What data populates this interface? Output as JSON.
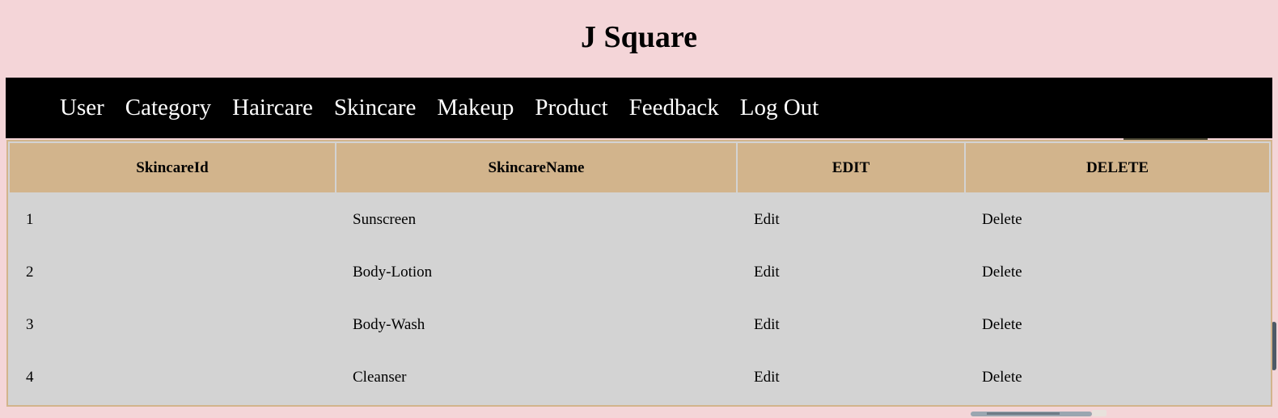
{
  "site": {
    "title": "J Square"
  },
  "nav": {
    "items": [
      {
        "label": "User"
      },
      {
        "label": "Category"
      },
      {
        "label": "Haircare"
      },
      {
        "label": "Skincare"
      },
      {
        "label": "Makeup"
      },
      {
        "label": "Product"
      },
      {
        "label": "Feedback"
      },
      {
        "label": "Log Out"
      }
    ]
  },
  "table": {
    "headers": {
      "id": "SkincareId",
      "name": "SkincareName",
      "edit": "EDIT",
      "delete": "DELETE"
    },
    "rows": [
      {
        "id": "1",
        "name": "Sunscreen",
        "edit": "Edit",
        "delete": "Delete"
      },
      {
        "id": "2",
        "name": "Body-Lotion",
        "edit": "Edit",
        "delete": "Delete"
      },
      {
        "id": "3",
        "name": "Body-Wash",
        "edit": "Edit",
        "delete": "Delete"
      },
      {
        "id": "4",
        "name": "Cleanser",
        "edit": "Edit",
        "delete": "Delete"
      }
    ]
  },
  "colors": {
    "page_background": "#f4d5d8",
    "nav_background": "#000000",
    "header_background": "#d2b48c",
    "row_background": "#d3d3d3"
  }
}
